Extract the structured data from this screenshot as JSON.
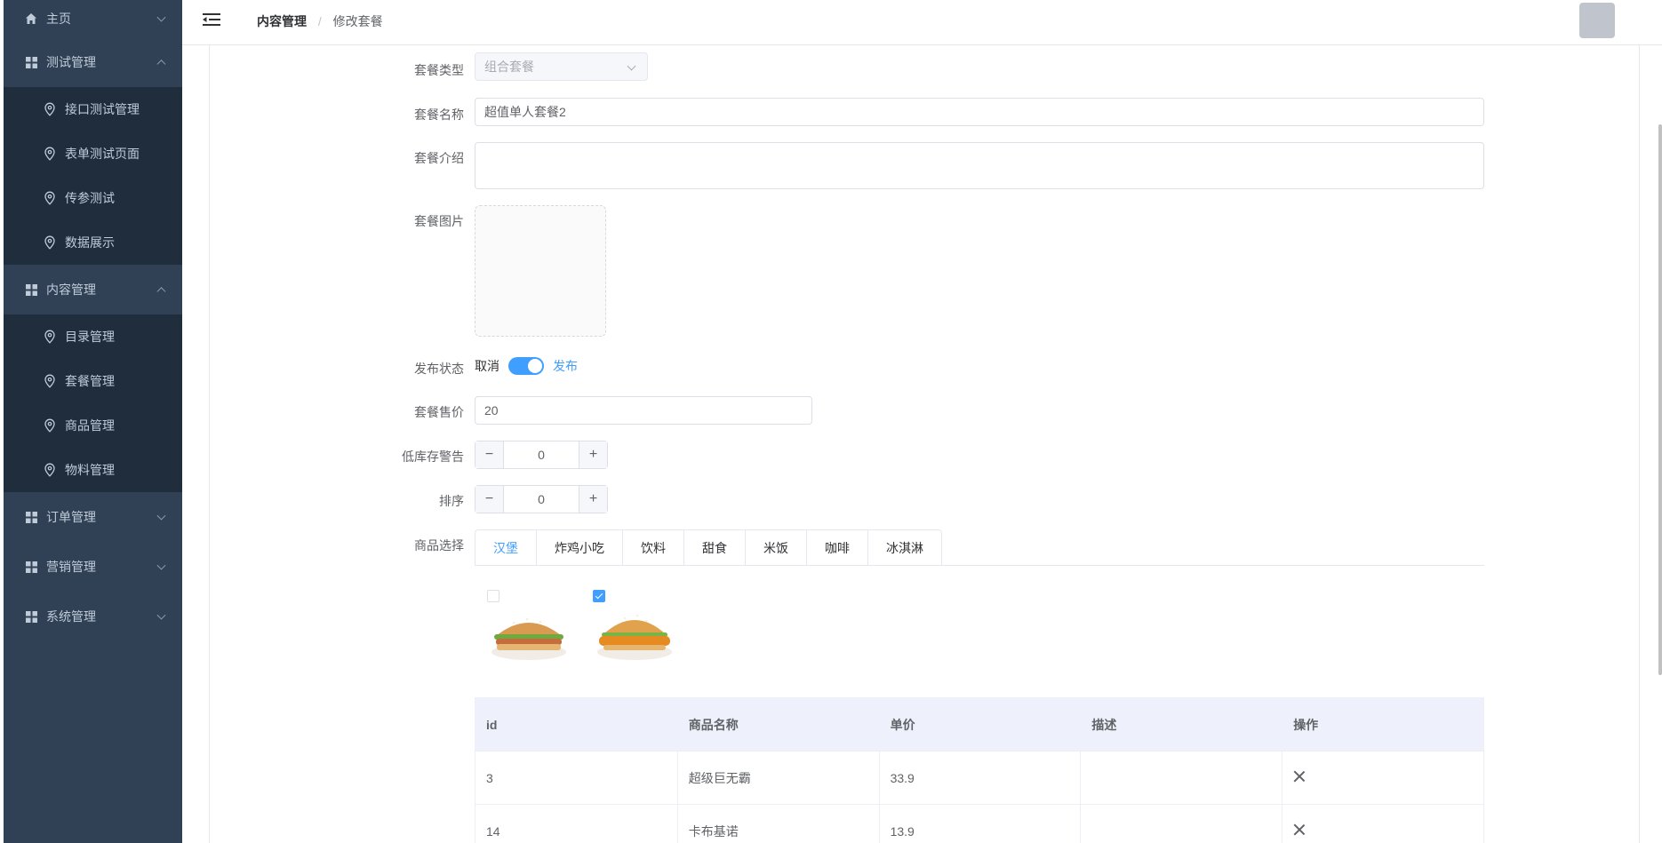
{
  "colors": {
    "sidebar_bg": "#304156",
    "submenu_bg": "#1f2d3d",
    "accent": "#409eff"
  },
  "sidebar": {
    "home": {
      "label": "主页",
      "icon": "home-icon"
    },
    "groups": [
      {
        "label": "测试管理",
        "icon": "grid-icon",
        "expanded": true,
        "items": [
          {
            "label": "接口测试管理"
          },
          {
            "label": "表单测试页面"
          },
          {
            "label": "传参测试"
          },
          {
            "label": "数据展示"
          }
        ]
      },
      {
        "label": "内容管理",
        "icon": "grid-icon",
        "expanded": true,
        "items": [
          {
            "label": "目录管理"
          },
          {
            "label": "套餐管理"
          },
          {
            "label": "商品管理"
          },
          {
            "label": "物料管理"
          }
        ]
      },
      {
        "label": "订单管理",
        "icon": "grid-icon",
        "expanded": false,
        "items": []
      },
      {
        "label": "营销管理",
        "icon": "grid-icon",
        "expanded": false,
        "items": []
      },
      {
        "label": "系统管理",
        "icon": "grid-icon",
        "expanded": false,
        "items": []
      }
    ]
  },
  "header": {
    "breadcrumb": {
      "parent": "内容管理",
      "separator": "/",
      "current": "修改套餐"
    }
  },
  "form": {
    "type": {
      "label": "套餐类型",
      "value": "组合套餐"
    },
    "name": {
      "label": "套餐名称",
      "value": "超值单人套餐2"
    },
    "intro": {
      "label": "套餐介绍",
      "value": ""
    },
    "image": {
      "label": "套餐图片"
    },
    "status": {
      "label": "发布状态",
      "off_text": "取消",
      "on_text": "发布",
      "on": true
    },
    "price": {
      "label": "套餐售价",
      "value": "20"
    },
    "stock_alert": {
      "label": "低库存警告",
      "value": "0",
      "minus": "−",
      "plus": "+"
    },
    "sort": {
      "label": "排序",
      "value": "0",
      "minus": "−",
      "plus": "+"
    },
    "product_select": {
      "label": "商品选择",
      "tabs": [
        "汉堡",
        "炸鸡小吃",
        "饮料",
        "甜食",
        "米饭",
        "咖啡",
        "冰淇淋"
      ],
      "active_tab": 0,
      "products": [
        {
          "checked": false
        },
        {
          "checked": true
        }
      ]
    }
  },
  "table": {
    "headers": [
      "id",
      "商品名称",
      "单价",
      "描述",
      "操作"
    ],
    "rows": [
      {
        "id": "3",
        "name": "超级巨无霸",
        "price": "33.9",
        "desc": ""
      },
      {
        "id": "14",
        "name": "卡布基诺",
        "price": "13.9",
        "desc": ""
      }
    ]
  }
}
